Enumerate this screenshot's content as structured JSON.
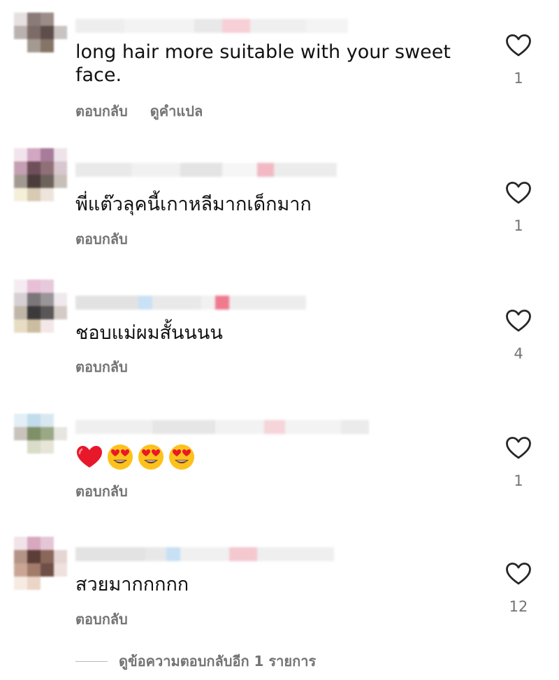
{
  "comments": [
    {
      "text": "long hair more suitable with your sweet face.",
      "actions": [
        "ตอบกลับ",
        "ดูคำแปล"
      ],
      "likes": "1",
      "emojis": []
    },
    {
      "text": "พี่แต๊วลุคนี้เกาหลีมากเด็กมาก",
      "actions": [
        "ตอบกลับ"
      ],
      "likes": "1",
      "emojis": []
    },
    {
      "text": "ชอบแม่ผมสั้นนนน",
      "actions": [
        "ตอบกลับ"
      ],
      "likes": "4",
      "emojis": []
    },
    {
      "text": "",
      "actions": [
        "ตอบกลับ"
      ],
      "likes": "1",
      "emojis": [
        "red-heart",
        "heart-eyes",
        "heart-eyes",
        "heart-eyes"
      ]
    },
    {
      "text": "สวยมากกกกก",
      "actions": [
        "ตอบกลับ"
      ],
      "likes": "12",
      "emojis": []
    }
  ],
  "more_replies_label": "ดูข้อความตอบกลับอีก 1 รายการ",
  "colors": {
    "action_text": "#737373",
    "heart_outline": "#262626",
    "text": "#111111"
  },
  "icons": {
    "like": "heart-outline-icon"
  }
}
